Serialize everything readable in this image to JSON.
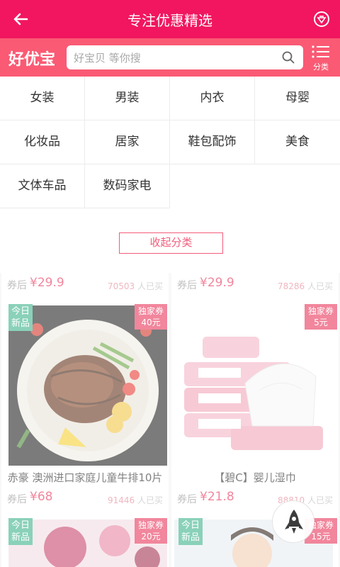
{
  "header": {
    "title": "专注优惠精选",
    "back_icon": "arrow-left-icon",
    "badge_icon": "vip-badge-icon"
  },
  "search": {
    "logo": "好优宝",
    "placeholder": "好宝贝 等你搜",
    "search_icon": "search-icon",
    "category_label": "分类",
    "category_icon": "list-icon"
  },
  "categories": [
    "女装",
    "男装",
    "内衣",
    "母婴",
    "化妆品",
    "居家",
    "鞋包配饰",
    "美食",
    "文体车品",
    "数码家电"
  ],
  "collapse_label": "收起分类",
  "products": [
    {
      "after_label": "券后",
      "price": "¥29.9",
      "sold_count": "70503",
      "sold_suffix": "人已买",
      "new_line1": "今日",
      "new_line2": "新品",
      "coupon_line1": "独家券",
      "coupon_line2": "40元",
      "name": "赤豪 澳洲进口家庭儿童牛排10片"
    },
    {
      "after_label": "券后",
      "price": "¥29.9",
      "sold_count": "78286",
      "sold_suffix": "人已买",
      "new_line1": "",
      "new_line2": "",
      "coupon_line1": "独家券",
      "coupon_line2": "5元",
      "name": "【碧C】婴儿湿巾"
    },
    {
      "after_label": "券后",
      "price": "¥68",
      "sold_count": "91446",
      "sold_suffix": "人已买",
      "new_line1": "今日",
      "new_line2": "新品",
      "coupon_line1": "独家券",
      "coupon_line2": "20元",
      "name": ""
    },
    {
      "after_label": "券后",
      "price": "¥21.8",
      "sold_count": "88810",
      "sold_suffix": "人已买",
      "new_line1": "今日",
      "new_line2": "新品",
      "coupon_line1": "独家券",
      "coupon_line2": "15元",
      "name": ""
    }
  ],
  "back_to_top_icon": "rocket-icon",
  "colors": {
    "brand": "#f1165f",
    "search_bar": "#fa5a74",
    "price": "#ea3a5f",
    "new_tag": "#43b58f",
    "coupon_tag": "#e83d5f"
  }
}
